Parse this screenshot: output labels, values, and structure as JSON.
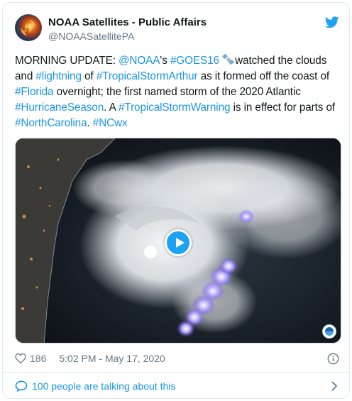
{
  "account": {
    "display_name": "NOAA Satellites - Public Affairs",
    "handle": "@NOAASatellitePA"
  },
  "tweet": {
    "segments": [
      {
        "text": "MORNING UPDATE: ",
        "link": false
      },
      {
        "text": "@NOAA",
        "link": true
      },
      {
        "text": "'s ",
        "link": false
      },
      {
        "text": "#GOES16",
        "link": true
      },
      {
        "text": " ",
        "link": false
      },
      {
        "text": "watched the clouds and ",
        "link": false
      },
      {
        "text": "#lightning",
        "link": true
      },
      {
        "text": " of ",
        "link": false
      },
      {
        "text": "#TropicalStormArthur",
        "link": true
      },
      {
        "text": " as it formed off the coast of ",
        "link": false
      },
      {
        "text": "#Florida",
        "link": true
      },
      {
        "text": " overnight; the first named storm of the 2020 Atlantic ",
        "link": false
      },
      {
        "text": "#HurricaneSeason",
        "link": true
      },
      {
        "text": ".  A ",
        "link": false
      },
      {
        "text": "#TropicalStormWarning",
        "link": true
      },
      {
        "text": " is in effect for parts of ",
        "link": false
      },
      {
        "text": "#NorthCarolina",
        "link": true
      },
      {
        "text": ". ",
        "link": false
      },
      {
        "text": "#NCwx",
        "link": true
      }
    ]
  },
  "stats": {
    "likes": "186",
    "timestamp": "5:02 PM - May 17, 2020"
  },
  "footer": {
    "talking_text": "100 people are talking about this"
  },
  "icons": {
    "bird": "twitter-bird-icon",
    "satellite_emoji": "satellite-emoji-icon",
    "play": "play-icon",
    "heart": "heart-icon",
    "info": "info-icon",
    "comment": "speech-bubble-icon",
    "chevron": "chevron-right-icon",
    "badge": "noaa-logo-icon"
  },
  "colors": {
    "link": "#1b95e0",
    "brand": "#1da1f2",
    "muted": "#657786",
    "border": "#e1e8ed"
  }
}
